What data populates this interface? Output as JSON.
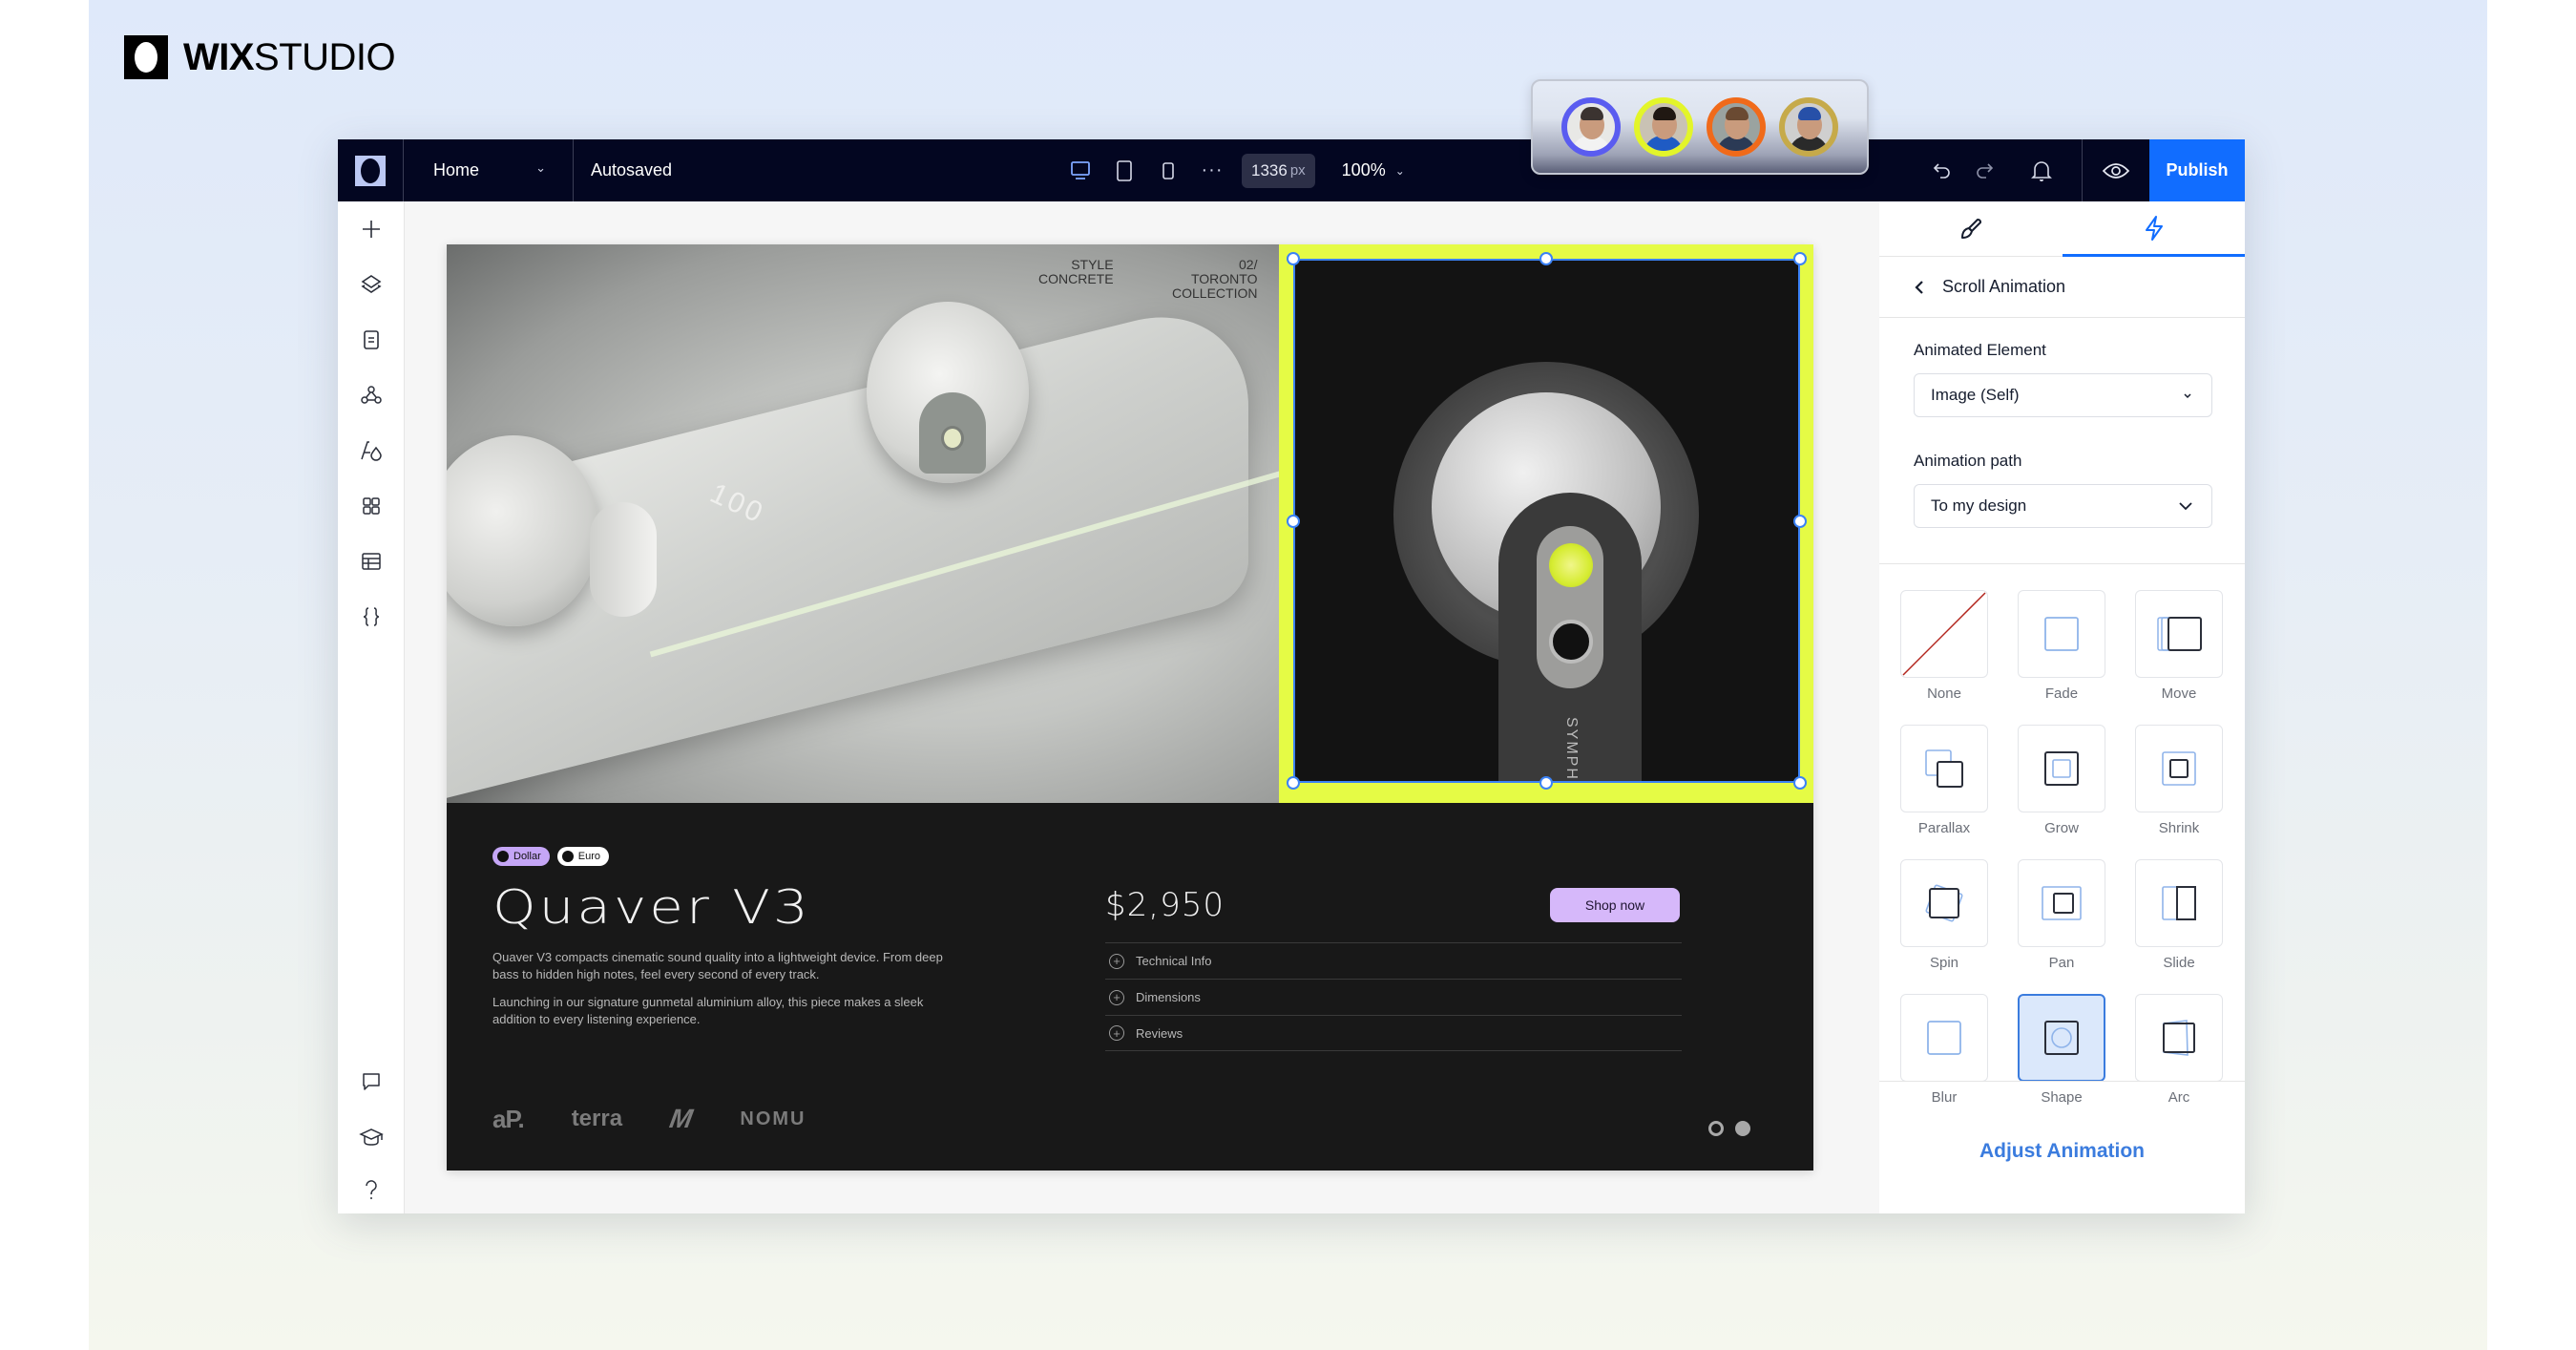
{
  "brand": {
    "name_bold": "WIX",
    "name_light": "STUDIO"
  },
  "topbar": {
    "page": "Home",
    "status": "Autosaved",
    "devices": [
      "desktop-icon",
      "tablet-icon",
      "mobile-icon"
    ],
    "more": "···",
    "width_value": "1336",
    "width_unit": "px",
    "zoom": "100%",
    "publish_label": "Publish"
  },
  "collaborators": [
    {
      "name": "collaborator-1",
      "ring": "#5a5cf0",
      "bg": "#e8e8e6",
      "shirt": "#f2f2f2",
      "hair": "#3b3330"
    },
    {
      "name": "collaborator-2",
      "ring": "#e3f52a",
      "bg": "#c9c2b4",
      "shirt": "#1f5bc4",
      "hair": "#201812"
    },
    {
      "name": "collaborator-3",
      "ring": "#f06a1a",
      "bg": "#9aa3a0",
      "shirt": "#2b3a55",
      "hair": "#6a4a32"
    },
    {
      "name": "collaborator-4",
      "ring": "#c6aa4a",
      "bg": "#cfcfcf",
      "shirt": "#2a2a2a",
      "hair": "#2750a8"
    }
  ],
  "left_sidebar": {
    "top_items": [
      "add-icon",
      "layers-icon",
      "pages-icon",
      "apps-icon",
      "design-icon",
      "blocks-icon",
      "cms-icon",
      "code-icon"
    ],
    "bottom_items": [
      "comments-icon",
      "academy-icon",
      "help-icon"
    ]
  },
  "canvas": {
    "caption_left": [
      "STYLE",
      "CONCRETE"
    ],
    "caption_right": [
      "02/",
      "TORONTO",
      "COLLECTION"
    ],
    "battery_readout": "100",
    "image_label": "SYMPHONY",
    "currency_pills": [
      "Dollar",
      "Euro"
    ],
    "product_title": "Quaver V3",
    "description": [
      "Quaver V3 compacts cinematic sound quality into a lightweight device. From deep bass to hidden high notes, feel every second of every track.",
      "Launching in our signature gunmetal  aluminium alloy, this piece makes a sleek addition to every listening experience."
    ],
    "price": "$2,950",
    "cta_label": "Shop now",
    "accordion": [
      "Technical Info",
      "Dimensions",
      "Reviews"
    ],
    "partner_logos": [
      "aP.",
      "terra",
      "M",
      "NOMU"
    ],
    "slider": {
      "total": 2,
      "active_index": 1
    }
  },
  "panel": {
    "tabs": [
      {
        "name": "design",
        "icon": "brush-icon",
        "active": false
      },
      {
        "name": "animation",
        "icon": "lightning-icon",
        "active": true
      }
    ],
    "header": "Scroll Animation",
    "animated_element_label": "Animated Element",
    "animated_element_value": "Image (Self)",
    "animation_path_label": "Animation path",
    "animation_path_value": "To my design",
    "animations": [
      {
        "label": "None",
        "selected": false
      },
      {
        "label": "Fade",
        "selected": false
      },
      {
        "label": "Move",
        "selected": false
      },
      {
        "label": "Parallax",
        "selected": false
      },
      {
        "label": "Grow",
        "selected": false
      },
      {
        "label": "Shrink",
        "selected": false
      },
      {
        "label": "Spin",
        "selected": false
      },
      {
        "label": "Pan",
        "selected": false
      },
      {
        "label": "Slide",
        "selected": false
      },
      {
        "label": "Blur",
        "selected": false
      },
      {
        "label": "Shape",
        "selected": true
      },
      {
        "label": "Arc",
        "selected": false
      }
    ],
    "adjust_label": "Adjust Animation"
  },
  "colors": {
    "topbar_bg": "#030621",
    "publish_blue": "#116dff",
    "selection_yellow": "#e5fb45",
    "selection_blue": "#3b82f6",
    "accent_purple": "#d6b8fa"
  }
}
